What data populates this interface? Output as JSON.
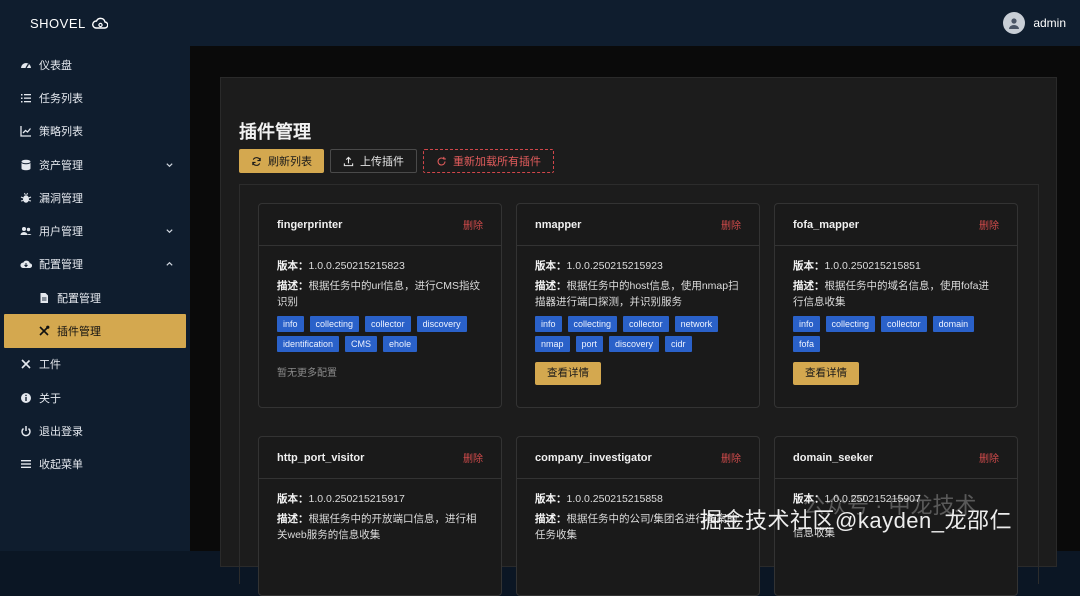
{
  "app": {
    "brand": "SHOVEL",
    "user": "admin"
  },
  "sidebar": {
    "items": [
      {
        "label": "仪表盘",
        "icon": "dashboard-icon"
      },
      {
        "label": "任务列表",
        "icon": "list-icon"
      },
      {
        "label": "策略列表",
        "icon": "chart-icon"
      },
      {
        "label": "资产管理",
        "icon": "database-icon"
      },
      {
        "label": "漏洞管理",
        "icon": "bug-icon"
      },
      {
        "label": "用户管理",
        "icon": "users-icon"
      },
      {
        "label": "配置管理",
        "icon": "cloud-icon"
      },
      {
        "label": "配置管理",
        "icon": "file-icon"
      },
      {
        "label": "插件管理",
        "icon": "tools-icon"
      },
      {
        "label": "工件",
        "icon": "wrench-icon"
      },
      {
        "label": "关于",
        "icon": "info-icon"
      },
      {
        "label": "退出登录",
        "icon": "power-icon"
      },
      {
        "label": "收起菜单",
        "icon": "menu-icon"
      }
    ]
  },
  "page": {
    "title": "插件管理",
    "refresh_label": "刷新列表",
    "upload_label": "上传插件",
    "reload_label": "重新加载所有插件"
  },
  "labels": {
    "version": "版本：",
    "desc": "描述：",
    "delete": "删除",
    "detail": "查看详情",
    "no_more": "暂无更多配置"
  },
  "plugins": [
    {
      "name": "fingerprinter",
      "version": "1.0.0.250215215823",
      "desc": "根据任务中的url信息，进行CMS指纹识别",
      "tags": [
        "info",
        "collecting",
        "collector",
        "discovery",
        "identification",
        "CMS",
        "ehole"
      ]
    },
    {
      "name": "nmapper",
      "version": "1.0.0.250215215923",
      "desc": "根据任务中的host信息，使用nmap扫描器进行端口探测，并识别服务",
      "tags": [
        "info",
        "collecting",
        "collector",
        "network",
        "nmap",
        "port",
        "discovery",
        "cidr"
      ]
    },
    {
      "name": "fofa_mapper",
      "version": "1.0.0.250215215851",
      "desc": "根据任务中的域名信息，使用fofa进行信息收集",
      "tags": [
        "info",
        "collecting",
        "collector",
        "domain",
        "fofa"
      ]
    },
    {
      "name": "http_port_visitor",
      "version": "1.0.0.250215215917",
      "desc": "根据任务中的开放端口信息，进行相关web服务的信息收集"
    },
    {
      "name": "company_investigator",
      "version": "1.0.0.250215215858",
      "desc": "根据任务中的公司/集团名进行备案的任务收集"
    },
    {
      "name": "domain_seeker",
      "version": "1.0.0.250215215907",
      "desc": "信息收集"
    }
  ],
  "watermark": {
    "main": "掘金技术社区@kayden_龙邵仁",
    "faint": "公众号 · 中龙技术"
  },
  "colors": {
    "accent": "#d4a84f",
    "tag": "#2a61c9",
    "danger": "#d24b4b",
    "sidebar_bg": "#0f1d2e"
  }
}
